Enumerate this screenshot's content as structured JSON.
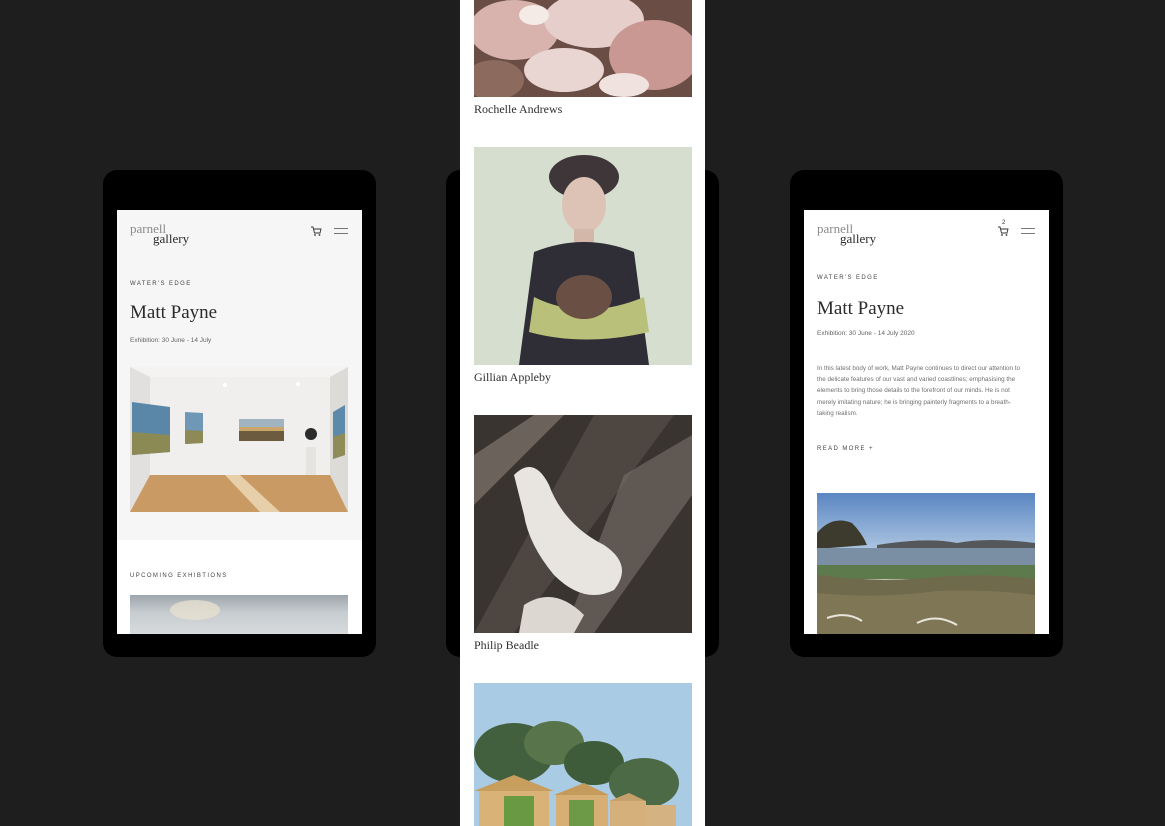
{
  "left_screen": {
    "logo_line1": "parnell",
    "logo_line2": "gallery",
    "eyebrow": "WATER'S EDGE",
    "title": "Matt Payne",
    "exhibition": "Exhibition: 30 June - 14 July",
    "section_label": "UPCOMING EXHIBTIONS"
  },
  "middle_column": {
    "artists": [
      {
        "name": "Rochelle Andrews"
      },
      {
        "name": "Gillian Appleby"
      },
      {
        "name": "Philip Beadle"
      }
    ]
  },
  "right_screen": {
    "logo_line1": "parnell",
    "logo_line2": "gallery",
    "cart_count": "2",
    "eyebrow": "WATER'S EDGE",
    "title": "Matt Payne",
    "exhibition": "Exhibition: 30 June - 14 July 2020",
    "paragraph": [
      "In this latest body of work, Matt Payne continues to direct our attention to",
      "the delicate features of our vast and varied coastlines; emphasising the",
      "elements to bring those details to the forefront of our minds. He is not",
      "merely imitating nature; he is bringing painterly fragments to a breath-",
      "taking realism."
    ],
    "read_more": "READ MORE +"
  }
}
